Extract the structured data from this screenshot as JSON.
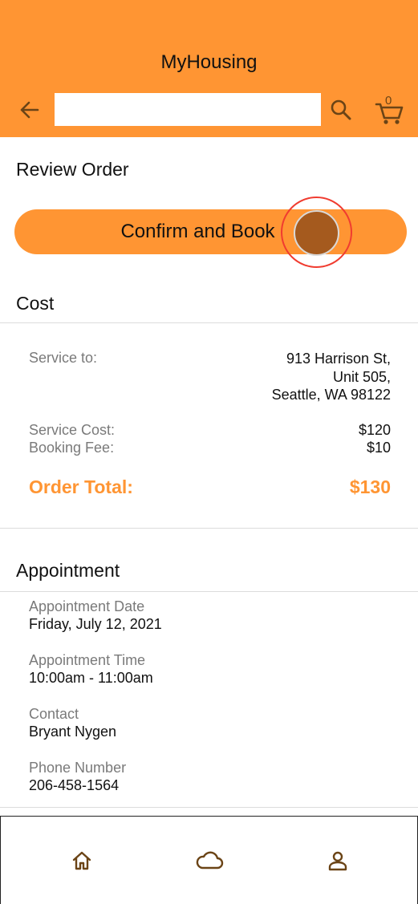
{
  "app": {
    "title": "MyHousing"
  },
  "search": {
    "placeholder": "",
    "value": ""
  },
  "cart": {
    "count": "0"
  },
  "review": {
    "heading": "Review Order",
    "confirm_label": "Confirm and Book"
  },
  "cost": {
    "heading": "Cost",
    "service_to_label": "Service to:",
    "address": [
      "913 Harrison St,",
      "Unit 505,",
      "Seattle, WA 98122"
    ],
    "service_cost_label": "Service Cost:",
    "service_cost_value": "$120",
    "booking_fee_label": "Booking Fee:",
    "booking_fee_value": "$10",
    "total_label": "Order Total:",
    "total_value": "$130"
  },
  "appointment": {
    "heading": "Appointment",
    "date_label": "Appointment Date",
    "date_value": "Friday, July 12, 2021",
    "time_label": "Appointment Time",
    "time_value": "10:00am - 11:00am",
    "contact_label": "Contact",
    "contact_value": "Bryant Nygen",
    "phone_label": "Phone Number",
    "phone_value": "206-458-1564"
  },
  "icons": {
    "back": "arrow-left-icon",
    "search": "search-icon",
    "cart": "cart-icon",
    "home": "home-icon",
    "cloud": "cloud-icon",
    "profile": "person-icon"
  },
  "colors": {
    "brand": "#FF9533",
    "icon": "#6B4416",
    "tap_ring": "#F03C30",
    "tap_dot": "#A55A1E"
  }
}
